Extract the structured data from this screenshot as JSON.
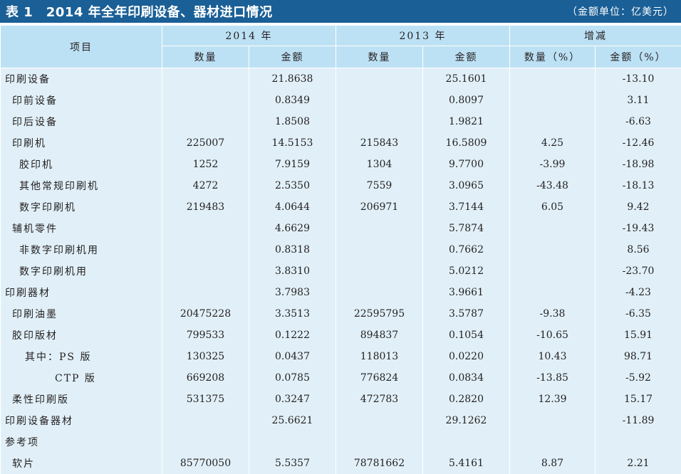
{
  "title": "表 1　2014 年全年印刷设备、器材进口情况",
  "unit": "（金额单位：亿美元）",
  "header": {
    "item": "项目",
    "year2014": "2014 年",
    "year2013": "2013 年",
    "change": "增减",
    "qty": "数量",
    "amount": "金额",
    "qty_pct": "数量（%）",
    "amount_pct": "金额（%）"
  },
  "rows": [
    {
      "name": "印刷设备",
      "q14": "",
      "a14": "21.8638",
      "q13": "",
      "a13": "25.1601",
      "qp": "",
      "ap": "-13.10"
    },
    {
      "name": "印前设备",
      "q14": "",
      "a14": "0.8349",
      "q13": "",
      "a13": "0.8097",
      "qp": "",
      "ap": "3.11"
    },
    {
      "name": "印后设备",
      "q14": "",
      "a14": "1.8508",
      "q13": "",
      "a13": "1.9821",
      "qp": "",
      "ap": "-6.63"
    },
    {
      "name": "印刷机",
      "q14": "225007",
      "a14": "14.5153",
      "q13": "215843",
      "a13": "16.5809",
      "qp": "4.25",
      "ap": "-12.46"
    },
    {
      "name": "胶印机",
      "q14": "1252",
      "a14": "7.9159",
      "q13": "1304",
      "a13": "9.7700",
      "qp": "-3.99",
      "ap": "-18.98"
    },
    {
      "name": "其他常规印刷机",
      "q14": "4272",
      "a14": "2.5350",
      "q13": "7559",
      "a13": "3.0965",
      "qp": "-43.48",
      "ap": "-18.13"
    },
    {
      "name": "数字印刷机",
      "q14": "219483",
      "a14": "4.0644",
      "q13": "206971",
      "a13": "3.7144",
      "qp": "6.05",
      "ap": "9.42"
    },
    {
      "name": "辅机零件",
      "q14": "",
      "a14": "4.6629",
      "q13": "",
      "a13": "5.7874",
      "qp": "",
      "ap": "-19.43"
    },
    {
      "name": "非数字印刷机用",
      "q14": "",
      "a14": "0.8318",
      "q13": "",
      "a13": "0.7662",
      "qp": "",
      "ap": "8.56"
    },
    {
      "name": "数字印刷机用",
      "q14": "",
      "a14": "3.8310",
      "q13": "",
      "a13": "5.0212",
      "qp": "",
      "ap": "-23.70"
    },
    {
      "name": "印刷器材",
      "q14": "",
      "a14": "3.7983",
      "q13": "",
      "a13": "3.9661",
      "qp": "",
      "ap": "-4.23"
    },
    {
      "name": "印刷油墨",
      "q14": "20475228",
      "a14": "3.3513",
      "q13": "22595795",
      "a13": "3.5787",
      "qp": "-9.38",
      "ap": "-6.35"
    },
    {
      "name": "胶印版材",
      "q14": "799533",
      "a14": "0.1222",
      "q13": "894837",
      "a13": "0.1054",
      "qp": "-10.65",
      "ap": "15.91"
    },
    {
      "name": "其中：PS 版",
      "q14": "130325",
      "a14": "0.0437",
      "q13": "118013",
      "a13": "0.0220",
      "qp": "10.43",
      "ap": "98.71"
    },
    {
      "name": "CTP 版",
      "q14": "669208",
      "a14": "0.0785",
      "q13": "776824",
      "a13": "0.0834",
      "qp": "-13.85",
      "ap": "-5.92"
    },
    {
      "name": "柔性印刷版",
      "q14": "531375",
      "a14": "0.3247",
      "q13": "472783",
      "a13": "0.2820",
      "qp": "12.39",
      "ap": "15.17"
    },
    {
      "name": "印刷设备器材",
      "q14": "",
      "a14": "25.6621",
      "q13": "",
      "a13": "29.1262",
      "qp": "",
      "ap": "-11.89"
    },
    {
      "name": "参考项",
      "q14": "",
      "a14": "",
      "q13": "",
      "a13": "",
      "qp": "",
      "ap": ""
    },
    {
      "name": "软片",
      "q14": "85770050",
      "a14": "5.5357",
      "q13": "78781662",
      "a13": "5.4161",
      "qp": "8.87",
      "ap": "2.21"
    }
  ]
}
